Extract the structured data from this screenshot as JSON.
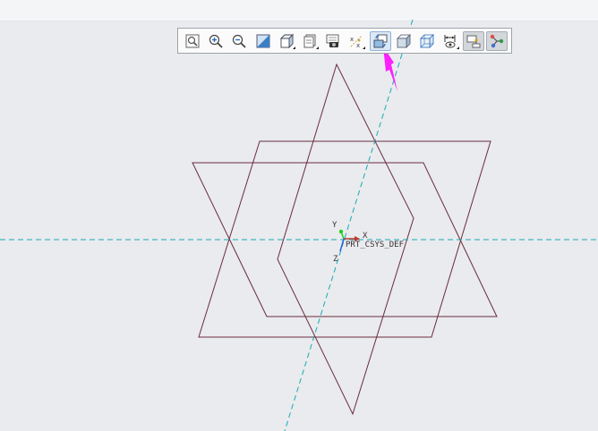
{
  "toolbar": {
    "buttons": [
      {
        "icon": "refit-icon",
        "state": "normal"
      },
      {
        "icon": "zoom-in-icon",
        "state": "normal"
      },
      {
        "icon": "zoom-out-icon",
        "state": "normal"
      },
      {
        "icon": "repaint-icon",
        "state": "normal"
      },
      {
        "icon": "saved-orientations-icon",
        "state": "normal"
      },
      {
        "icon": "view-manager-icon",
        "state": "normal"
      },
      {
        "icon": "appearance-manager-icon",
        "state": "normal"
      },
      {
        "icon": "datum-display-filter-icon",
        "state": "normal"
      },
      {
        "icon": "reorient-icon",
        "state": "highlighted"
      },
      {
        "icon": "display-style-shading-icon",
        "state": "normal"
      },
      {
        "icon": "display-style-wireframe-icon",
        "state": "normal"
      },
      {
        "icon": "annotation-display-icon",
        "state": "normal"
      },
      {
        "icon": "spin-center-icon",
        "state": "pressed"
      },
      {
        "icon": "connection-icon",
        "state": "pressed"
      }
    ]
  },
  "viewport": {
    "csys_label": "PRT_CSYS_DEF",
    "axis_x_label": "X",
    "axis_y_label": "Y",
    "axis_z_label": "Z"
  },
  "colors": {
    "background": "#e9ebee",
    "datum_plane": "#6b2c3e",
    "datum_axis": "#1ba8b3",
    "annotation_arrow": "#ff1fff",
    "csys_x": "#c0392b",
    "csys_y": "#22cc22",
    "csys_z": "#2266dd"
  }
}
